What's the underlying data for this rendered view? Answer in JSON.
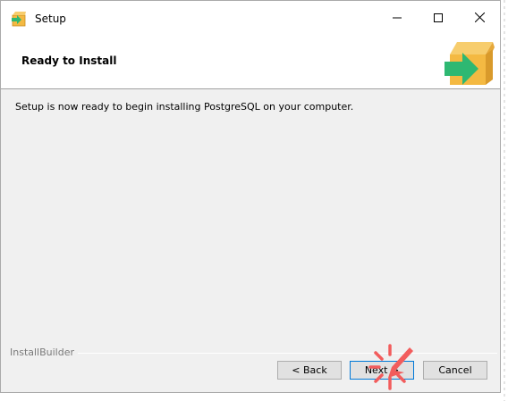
{
  "window": {
    "title": "Setup"
  },
  "header": {
    "title": "Ready to Install",
    "logo_icon": "box-arrow-icon"
  },
  "content": {
    "message": "Setup is now ready to begin installing PostgreSQL on your computer."
  },
  "footer": {
    "brand": "InstallBuilder"
  },
  "buttons": {
    "back": "< Back",
    "next": "Next >",
    "cancel": "Cancel"
  },
  "colors": {
    "box_orange": "#f4b942",
    "arrow_green": "#2eb872",
    "focus_blue": "#0078d7",
    "cursor_red": "#f25c5c"
  }
}
